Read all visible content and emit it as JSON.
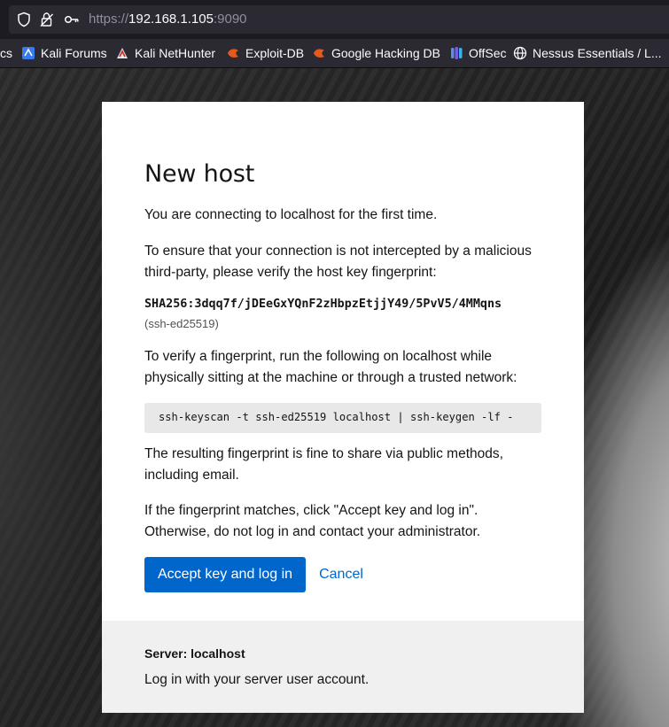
{
  "browser": {
    "url": {
      "scheme": "https://",
      "host": "192.168.1.105",
      "port": ":9090"
    },
    "bookmarks": [
      {
        "label": "cs",
        "icon": "docs-favicon"
      },
      {
        "label": "Kali Forums",
        "icon": "kali-forums-favicon"
      },
      {
        "label": "Kali NetHunter",
        "icon": "kali-nethunter-favicon"
      },
      {
        "label": "Exploit-DB",
        "icon": "exploit-db-favicon"
      },
      {
        "label": "Google Hacking DB",
        "icon": "google-hacking-db-favicon"
      },
      {
        "label": "OffSec",
        "icon": "offsec-favicon"
      },
      {
        "label": "Nessus Essentials / L...",
        "icon": "globe-icon"
      }
    ]
  },
  "dialog": {
    "title": "New host",
    "intro": "You are connecting to localhost for the first time.",
    "ensure": "To ensure that your connection is not intercepted by a malicious third-party, please verify the host key fingerprint:",
    "fingerprint": "SHA256:3dqq7f/jDEeGxYQnF2zHbpzEtjjY49/5PvV5/4MMqns",
    "key_type": "(ssh-ed25519)",
    "verify": "To verify a fingerprint, run the following on localhost while physically sitting at the machine or through a trusted network:",
    "command": "ssh-keyscan -t ssh-ed25519 localhost | ssh-keygen -lf -",
    "share": "The resulting fingerprint is fine to share via public methods, including email.",
    "matches": "If the fingerprint matches, click \"Accept key and log in\". Otherwise, do not log in and contact your administrator.",
    "accept_label": "Accept key and log in",
    "cancel_label": "Cancel"
  },
  "footer": {
    "server": "Server: localhost",
    "hint": "Log in with your server user account."
  },
  "colors": {
    "primary": "#0066cc",
    "footer_bg": "#f0f0f0",
    "code_bg": "#e8e8e8"
  }
}
